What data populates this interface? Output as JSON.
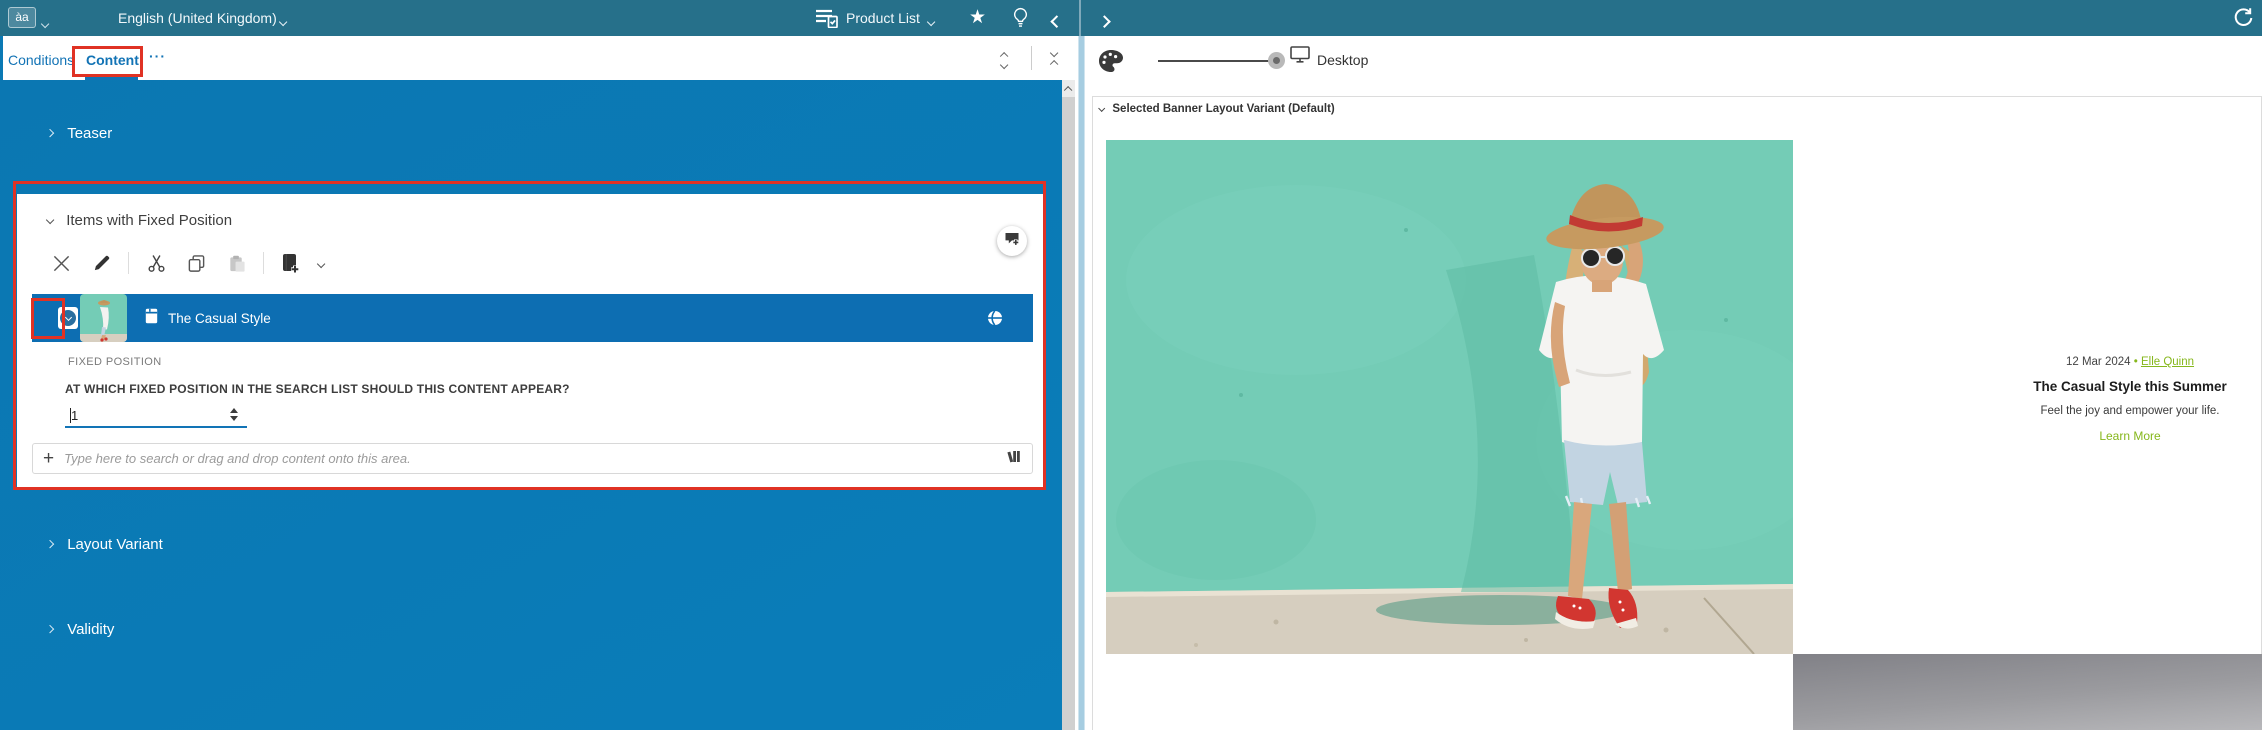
{
  "topbar": {
    "language_badge": "àa",
    "language": "English (United Kingdom)",
    "page": "Product List"
  },
  "tabbar": {
    "conditions": "Conditions",
    "content": "Content",
    "more": "···"
  },
  "sections": {
    "teaser": "Teaser",
    "items": "Items with Fixed Position",
    "layout_variant": "Layout Variant",
    "validity": "Validity"
  },
  "items": {
    "selected_title": "The Casual Style",
    "field_label": "FIXED POSITION",
    "question": "AT WHICH FIXED POSITION IN THE SEARCH LIST SHOULD THIS CONTENT APPEAR?",
    "position_value": "1",
    "search_placeholder": "Type here to search or drag and drop content onto this area."
  },
  "preview": {
    "device": "Desktop",
    "variant_header": "Selected Banner Layout Variant (Default)",
    "banner": {
      "date": "12 Mar 2024",
      "bullet": "•",
      "author": "Elle Quinn",
      "title": "The Casual Style this Summer",
      "subtitle": "Feel the joy and empower your life.",
      "cta": "Learn More"
    }
  },
  "colors": {
    "panel_blue": "#0a79b4",
    "selected_blue": "#0d6eb2",
    "topbar_teal": "#26708a",
    "highlight_red": "#e03224",
    "link_green": "#86b71c",
    "photo_teal": "#74ccb6"
  }
}
